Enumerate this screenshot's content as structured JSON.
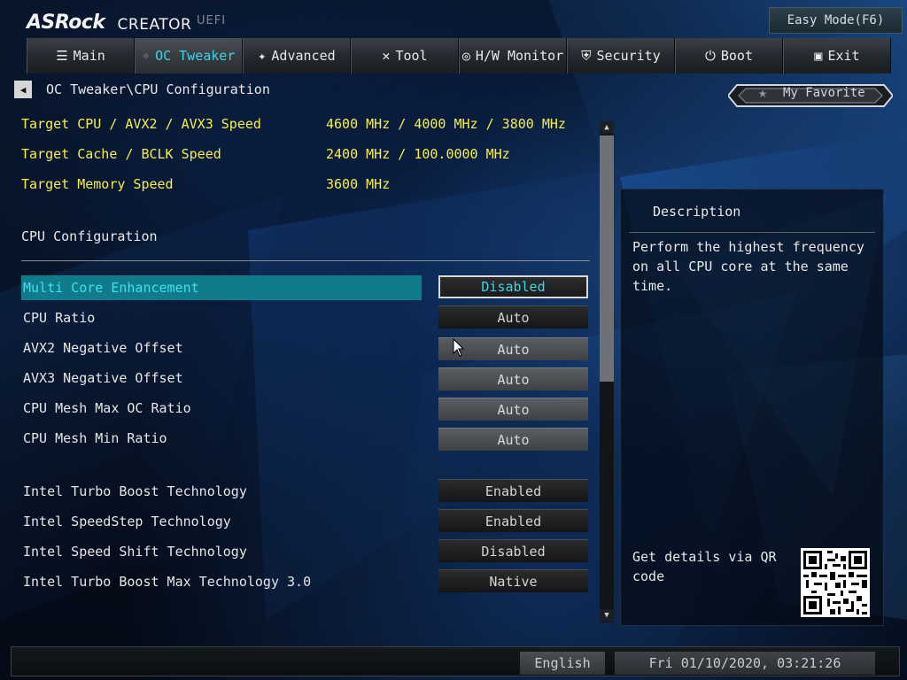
{
  "header": {
    "brand": "ASRock",
    "product": "CREATOR",
    "sub": "UEFI",
    "easy_mode_label": "Easy Mode(F6)"
  },
  "tabs": [
    {
      "label": "Main",
      "icon": "list-icon"
    },
    {
      "label": "OC Tweaker",
      "icon": "rocket-icon",
      "active": true
    },
    {
      "label": "Advanced",
      "icon": "star-icon"
    },
    {
      "label": "Tool",
      "icon": "tools-icon"
    },
    {
      "label": "H/W Monitor",
      "icon": "monitor-icon"
    },
    {
      "label": "Security",
      "icon": "shield-icon"
    },
    {
      "label": "Boot",
      "icon": "power-icon"
    },
    {
      "label": "Exit",
      "icon": "exit-icon"
    }
  ],
  "breadcrumb": "OC Tweaker\\CPU Configuration",
  "favorite_label": "My Favorite",
  "info": [
    {
      "label": "Target CPU   / AVX2 / AVX3 Speed",
      "value": "4600 MHz / 4000 MHz / 3800 MHz"
    },
    {
      "label": "Target Cache / BCLK Speed",
      "value": "2400 MHz / 100.0000 MHz"
    },
    {
      "label": "Target Memory Speed",
      "value": "3600 MHz"
    }
  ],
  "section_title": "CPU Configuration",
  "settings": [
    {
      "label": "Multi Core Enhancement",
      "value": "Disabled"
    },
    {
      "label": "CPU Ratio",
      "value": "Auto"
    },
    {
      "label": "AVX2 Negative Offset",
      "value": "Auto"
    },
    {
      "label": "AVX3 Negative Offset",
      "value": "Auto"
    },
    {
      "label": "CPU Mesh Max OC Ratio",
      "value": "Auto"
    },
    {
      "label": "CPU Mesh Min Ratio",
      "value": "Auto"
    },
    {
      "label": "Intel Turbo Boost Technology",
      "value": "Enabled"
    },
    {
      "label": "Intel SpeedStep Technology",
      "value": "Enabled"
    },
    {
      "label": "Intel Speed Shift Technology",
      "value": "Disabled"
    },
    {
      "label": "Intel Turbo Boost Max Technology 3.0",
      "value": "Native"
    }
  ],
  "description": {
    "title": "Description",
    "text": "Perform the highest frequency on all CPU core at the same time.",
    "qr_text": "Get details via QR code"
  },
  "footer": {
    "language": "English",
    "datetime": "Fri 01/10/2020, 03:21:26"
  },
  "colors": {
    "accent": "#3fd4e6",
    "info_text": "#f6ee4b",
    "selection_bg": "#0f7b8b"
  }
}
